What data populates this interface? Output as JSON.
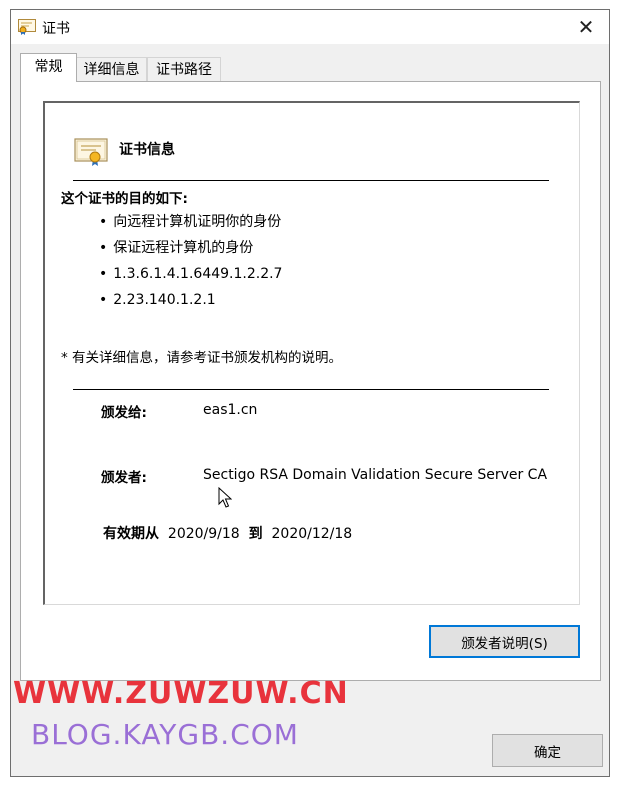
{
  "window": {
    "title": "证书",
    "close_glyph": "✕"
  },
  "tabs": [
    {
      "label": "常规",
      "active": true
    },
    {
      "label": "详细信息",
      "active": false
    },
    {
      "label": "证书路径",
      "active": false
    }
  ],
  "general": {
    "section_title": "证书信息",
    "purpose_heading": "这个证书的目的如下:",
    "purposes": [
      "向远程计算机证明你的身份",
      "保证远程计算机的身份",
      "1.3.6.1.4.1.6449.1.2.2.7",
      "2.23.140.1.2.1"
    ],
    "note": "* 有关详细信息，请参考证书颁发机构的说明。",
    "issued_to_label": "颁发给:",
    "issued_to_value": "eas1.cn",
    "issued_by_label": "颁发者:",
    "issued_by_value": "Sectigo RSA Domain Validation Secure Server CA",
    "valid_from_label": "有效期从",
    "valid_from": "2020/9/18",
    "valid_to_label": "到",
    "valid_to": "2020/12/18"
  },
  "buttons": {
    "issuer_statement": "颁发者说明(S)",
    "ok": "确定"
  },
  "watermarks": {
    "line1": "WWW.ZUWZUW.CN",
    "line2": "BLOG.KAYGB.COM"
  },
  "icons": {
    "title_icon": "certificate-icon",
    "section_icon": "certificate-icon",
    "close_icon": "close-icon",
    "cursor": "mouse-cursor-icon"
  },
  "colors": {
    "watermark_red": "#e8333c",
    "watermark_purple": "#9a6fd6",
    "focus_border": "#0078d7"
  }
}
